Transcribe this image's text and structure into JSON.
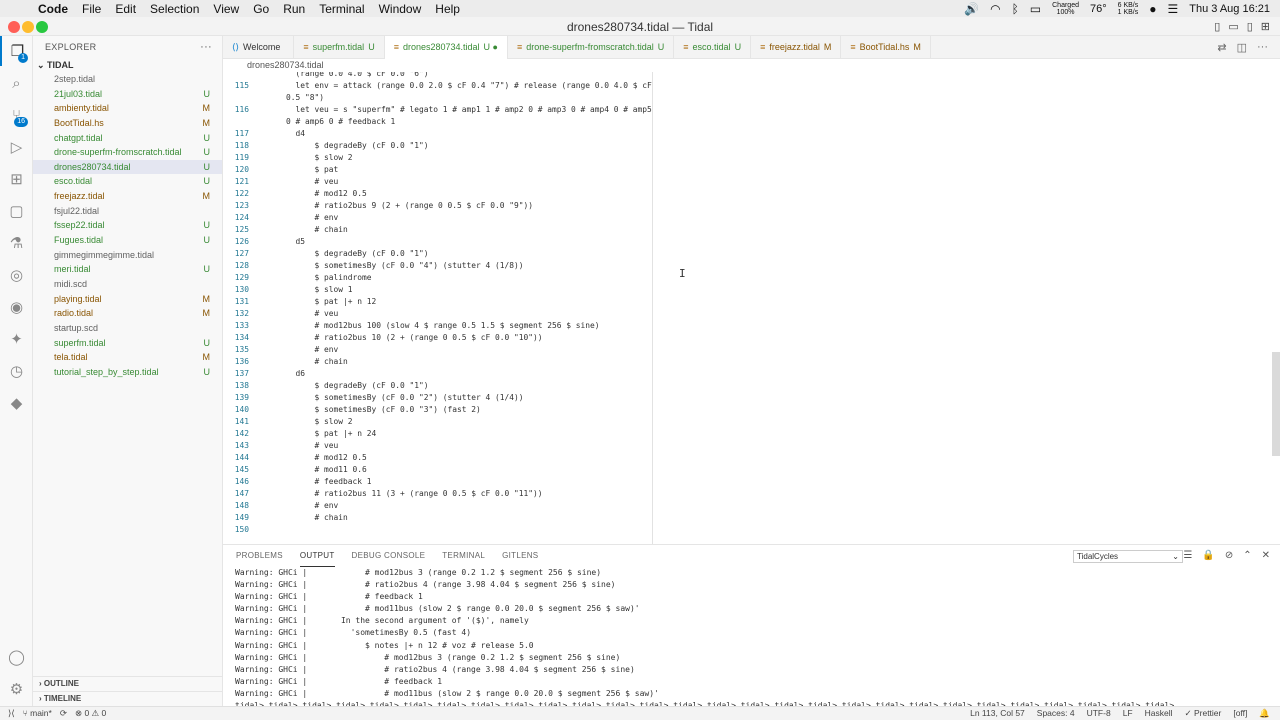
{
  "menubar": {
    "app": "Code",
    "items": [
      "File",
      "Edit",
      "Selection",
      "View",
      "Go",
      "Run",
      "Terminal",
      "Window",
      "Help"
    ],
    "battery": "Charged",
    "battery_pct": "100%",
    "temp": "76°",
    "net_up": "6 KB/s",
    "net_down": "1 KB/s",
    "clock": "Thu 3 Aug  16:21"
  },
  "window": {
    "title": "drones280734.tidal — Tidal"
  },
  "activity": {
    "scm_badge": "16",
    "explorer_badge": "1"
  },
  "explorer": {
    "header": "EXPLORER",
    "folder": "TIDAL",
    "files": [
      {
        "name": "2step.tidal",
        "status": "",
        "color": "plain"
      },
      {
        "name": "21jul03.tidal",
        "status": "U",
        "color": "green"
      },
      {
        "name": "ambienty.tidal",
        "status": "M",
        "color": "brown"
      },
      {
        "name": "BootTidal.hs",
        "status": "M",
        "color": "brown"
      },
      {
        "name": "chatgpt.tidal",
        "status": "U",
        "color": "green"
      },
      {
        "name": "drone-superfm-fromscratch.tidal",
        "status": "U",
        "color": "green"
      },
      {
        "name": "drones280734.tidal",
        "status": "U",
        "color": "green"
      },
      {
        "name": "esco.tidal",
        "status": "U",
        "color": "green"
      },
      {
        "name": "freejazz.tidal",
        "status": "M",
        "color": "brown"
      },
      {
        "name": "fsjul22.tidal",
        "status": "",
        "color": "plain"
      },
      {
        "name": "fssep22.tidal",
        "status": "U",
        "color": "green"
      },
      {
        "name": "Fugues.tidal",
        "status": "U",
        "color": "green"
      },
      {
        "name": "gimmegimmegimme.tidal",
        "status": "",
        "color": "plain"
      },
      {
        "name": "meri.tidal",
        "status": "U",
        "color": "green"
      },
      {
        "name": "midi.scd",
        "status": "",
        "color": "plain"
      },
      {
        "name": "playing.tidal",
        "status": "M",
        "color": "brown"
      },
      {
        "name": "radio.tidal",
        "status": "M",
        "color": "brown"
      },
      {
        "name": "startup.scd",
        "status": "",
        "color": "plain"
      },
      {
        "name": "superfm.tidal",
        "status": "U",
        "color": "green"
      },
      {
        "name": "tela.tidal",
        "status": "M",
        "color": "brown"
      },
      {
        "name": "tutorial_step_by_step.tidal",
        "status": "U",
        "color": "green"
      }
    ],
    "outline": "OUTLINE",
    "timeline": "TIMELINE"
  },
  "tabs": [
    {
      "name": "Welcome",
      "status": ""
    },
    {
      "name": "superfm.tidal",
      "status": "U"
    },
    {
      "name": "drones280734.tidal",
      "status": "U ●"
    },
    {
      "name": "drone-superfm-fromscratch.tidal",
      "status": "U"
    },
    {
      "name": "esco.tidal",
      "status": "U"
    },
    {
      "name": "freejazz.tidal",
      "status": "M"
    },
    {
      "name": "BootTidal.hs",
      "status": "M"
    }
  ],
  "breadcrumb": "drones280734.tidal",
  "editor_lines": [
    {
      "n": "",
      "t": "  (range 0.0 4.0 $ cF 0.0 \"6\")"
    },
    {
      "n": "115",
      "t": "  let env = attack (range 0.0 2.0 $ cF 0.4 \"7\") # release (range 0.0 4.0 $ cF"
    },
    {
      "n": "",
      "t": "0.5 \"8\")"
    },
    {
      "n": "116",
      "t": "  let veu = s \"superfm\" # legato 1 # amp1 1 # amp2 0 # amp3 0 # amp4 0 # amp5"
    },
    {
      "n": "",
      "t": "0 # amp6 0 # feedback 1"
    },
    {
      "n": "117",
      "t": "  d4"
    },
    {
      "n": "118",
      "t": "      $ degradeBy (cF 0.0 \"1\")"
    },
    {
      "n": "119",
      "t": "      $ slow 2"
    },
    {
      "n": "120",
      "t": "      $ pat"
    },
    {
      "n": "121",
      "t": "      # veu"
    },
    {
      "n": "122",
      "t": "      # mod12 0.5"
    },
    {
      "n": "123",
      "t": "      # ratio2bus 9 (2 + (range 0 0.5 $ cF 0.0 \"9\"))"
    },
    {
      "n": "124",
      "t": "      # env"
    },
    {
      "n": "125",
      "t": "      # chain"
    },
    {
      "n": "126",
      "t": "  d5"
    },
    {
      "n": "127",
      "t": "      $ degradeBy (cF 0.0 \"1\")"
    },
    {
      "n": "128",
      "t": "      $ sometimesBy (cF 0.0 \"4\") (stutter 4 (1/8))"
    },
    {
      "n": "129",
      "t": "      $ palindrome"
    },
    {
      "n": "130",
      "t": "      $ slow 1"
    },
    {
      "n": "131",
      "t": "      $ pat |+ n 12"
    },
    {
      "n": "132",
      "t": "      # veu"
    },
    {
      "n": "133",
      "t": "      # mod12bus 100 (slow 4 $ range 0.5 1.5 $ segment 256 $ sine)"
    },
    {
      "n": "134",
      "t": "      # ratio2bus 10 (2 + (range 0 0.5 $ cF 0.0 \"10\"))"
    },
    {
      "n": "135",
      "t": "      # env"
    },
    {
      "n": "136",
      "t": "      # chain"
    },
    {
      "n": "137",
      "t": "  d6"
    },
    {
      "n": "138",
      "t": "      $ degradeBy (cF 0.0 \"1\")"
    },
    {
      "n": "139",
      "t": "      $ sometimesBy (cF 0.0 \"2\") (stutter 4 (1/4))"
    },
    {
      "n": "140",
      "t": "      $ sometimesBy (cF 0.0 \"3\") (fast 2)"
    },
    {
      "n": "141",
      "t": "      $ slow 2"
    },
    {
      "n": "142",
      "t": "      $ pat |+ n 24"
    },
    {
      "n": "143",
      "t": "      # veu"
    },
    {
      "n": "144",
      "t": "      # mod12 0.5"
    },
    {
      "n": "145",
      "t": "      # mod11 0.6"
    },
    {
      "n": "146",
      "t": "      # feedback 1"
    },
    {
      "n": "147",
      "t": "      # ratio2bus 11 (3 + (range 0 0.5 $ cF 0.0 \"11\"))"
    },
    {
      "n": "148",
      "t": "      # env"
    },
    {
      "n": "149",
      "t": "      # chain"
    },
    {
      "n": "150",
      "t": ""
    }
  ],
  "panel": {
    "tabs": [
      "PROBLEMS",
      "OUTPUT",
      "DEBUG CONSOLE",
      "TERMINAL",
      "GITLENS"
    ],
    "active_tab": "OUTPUT",
    "channel": "TidalCycles",
    "lines": [
      "Warning: GHCi |            # mod12bus 3 (range 0.2 1.2 $ segment 256 $ sine)",
      "Warning: GHCi |            # ratio2bus 4 (range 3.98 4.04 $ segment 256 $ sine)",
      "Warning: GHCi |            # feedback 1",
      "Warning: GHCi |            # mod11bus (slow 2 $ range 0.0 20.0 $ segment 256 $ saw)'",
      "Warning: GHCi |       In the second argument of '($)', namely",
      "Warning: GHCi |         'sometimesBy 0.5 (fast 4)",
      "Warning: GHCi |            $ notes |+ n 12 # voz # release 5.0",
      "Warning: GHCi |                # mod12bus 3 (range 0.2 1.2 $ segment 256 $ sine)",
      "Warning: GHCi |                # ratio2bus 4 (range 3.98 4.04 $ segment 256 $ sine)",
      "Warning: GHCi |                # feedback 1",
      "Warning: GHCi |                # mod11bus (slow 2 $ range 0.0 20.0 $ segment 256 $ saw)'",
      "tidal> tidal> tidal> tidal> tidal> tidal> tidal> tidal> tidal> tidal> tidal> tidal> tidal> tidal> tidal> tidal> tidal> tidal> tidal> tidal> tidal> tidal> tidal> tidal> tidal> tidal> tidal> tidal>"
    ]
  },
  "statusbar": {
    "branch": "main*",
    "problems": "⊗ 0 ⚠ 0",
    "position": "Ln 113, Col 57",
    "spaces": "Spaces: 4",
    "encoding": "UTF-8",
    "eol": "LF",
    "language": "Haskell",
    "prettier": "✓ Prettier",
    "off": "[off]"
  },
  "colors": {
    "accent": "#007acc",
    "untracked": "#388a34",
    "modified": "#895503"
  }
}
